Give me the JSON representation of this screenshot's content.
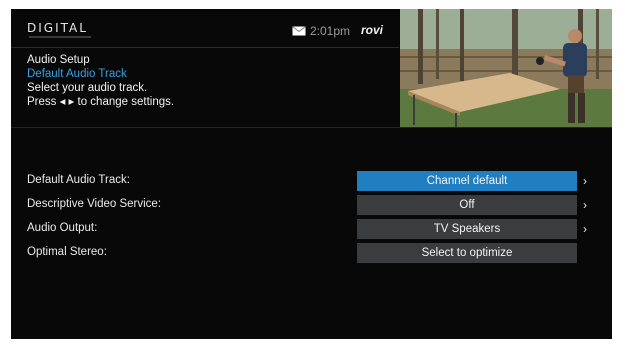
{
  "header": {
    "logo": "DIGITAL",
    "clock": "2:01pm",
    "brand": "rovi",
    "mail_icon": "envelope-icon"
  },
  "info": {
    "title": "Audio Setup",
    "subtitle": "Default Audio Track",
    "instruction": "Select your audio track.",
    "hint": "Press ◂ ▸ to change settings."
  },
  "settings": [
    {
      "label": "Default Audio Track:",
      "value": "Channel default",
      "selected": true,
      "has_arrow": true
    },
    {
      "label": "Descriptive Video Service:",
      "value": "Off",
      "selected": false,
      "has_arrow": true
    },
    {
      "label": "Audio Output:",
      "value": "TV Speakers",
      "selected": false,
      "has_arrow": true
    },
    {
      "label": "Optimal Stereo:",
      "value": "Select to optimize",
      "selected": false,
      "has_arrow": false
    }
  ],
  "colors": {
    "accent": "#1f7fc1",
    "subtitle": "#3aa0e0",
    "value_bg": "#3a3c3e",
    "background": "#080808"
  }
}
